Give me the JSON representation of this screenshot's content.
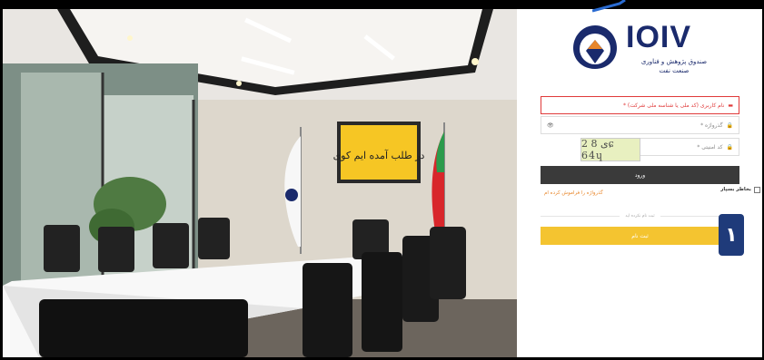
{
  "brand": {
    "logo_text": "IOIV",
    "name_line1": "صندوق پژوهش و فناوری",
    "name_line2": "صنعت نفت"
  },
  "photo": {
    "calligraphy": "در طلب آمده ایم کوی"
  },
  "form": {
    "username_placeholder": "نام کاربری (کد ملی یا شناسه ملی شرکت) *",
    "password_placeholder": "گذرواژه *",
    "captcha_placeholder": "کد امنیتی *",
    "captcha_text": "ی 8 2ɕ 64ɥ",
    "login_button": "ورود",
    "remember_me": "بخاطر بسپار",
    "forgot_password": "گذرواژه را فراموش کرده ام",
    "register_hint": "ثبت نام نکرده اید",
    "register_button": "ثبت نام",
    "step_badge": "۱"
  },
  "colors": {
    "brand_navy": "#1a2a6c",
    "brand_orange": "#e8862a",
    "login_bg": "#3a3a3a",
    "register_bg": "#f4c430",
    "badge_bg": "#1f3b7a",
    "error_red": "#e03a3a"
  }
}
